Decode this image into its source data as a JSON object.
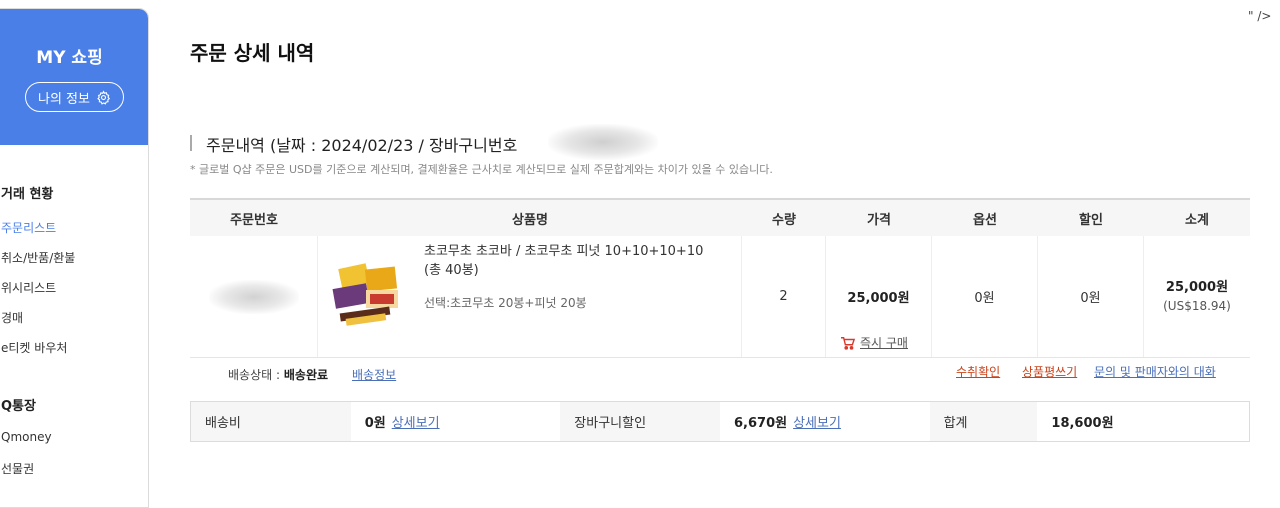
{
  "stray_text": "\" />",
  "sidebar": {
    "title": "MY 쇼핑",
    "my_info": "나의 정보",
    "section1": "거래 현황",
    "items1": [
      "주문리스트",
      "취소/반품/환불",
      "위시리스트",
      "경매",
      "e티켓 바우처"
    ],
    "section2": "Q통장",
    "items2": [
      "Qmoney",
      "선물권"
    ]
  },
  "page_title": "주문 상세 내역",
  "order_section": {
    "title": "주문내역 (날짜 : 2024/02/23 / 장바구니번호",
    "notice": "* 글로벌 Q샵 주문은 USD를 기준으로 계산되며, 결제환율은 근사치로 계산되므로 실제 주문합계와는 차이가 있을 수 있습니다."
  },
  "table": {
    "headers": [
      "주문번호",
      "상품명",
      "수량",
      "가격",
      "옵션",
      "할인",
      "소계"
    ],
    "row": {
      "product_name": "초코무초 초코바 / 초코무초 피넛 10+10+10+10 (총 40봉)",
      "option": "선택:초코무초 20봉+피넛 20봉",
      "quantity": "2",
      "price": "25,000원",
      "buy_now": "즉시 구매",
      "option_price": "0원",
      "discount": "0원",
      "subtotal_krw": "25,000원",
      "subtotal_usd": "(US$18.94)"
    }
  },
  "shipping": {
    "status_label": "배송상태 :",
    "status_value": "배송완료",
    "info_link": "배송정보",
    "actions": [
      "수취확인",
      "상품평쓰기",
      "문의 및 판매자와의 대화"
    ]
  },
  "summary": {
    "shipping_fee_label": "배송비",
    "shipping_fee_value": "0원",
    "shipping_fee_link": "상세보기",
    "cart_discount_label": "장바구니할인",
    "cart_discount_value": "6,670원",
    "cart_discount_link": "상세보기",
    "total_label": "합계",
    "total_value": "18,600원"
  },
  "colors": {
    "accent": "#4a7fe8",
    "link": "#4a6fb8",
    "action_red": "#c8441c"
  }
}
